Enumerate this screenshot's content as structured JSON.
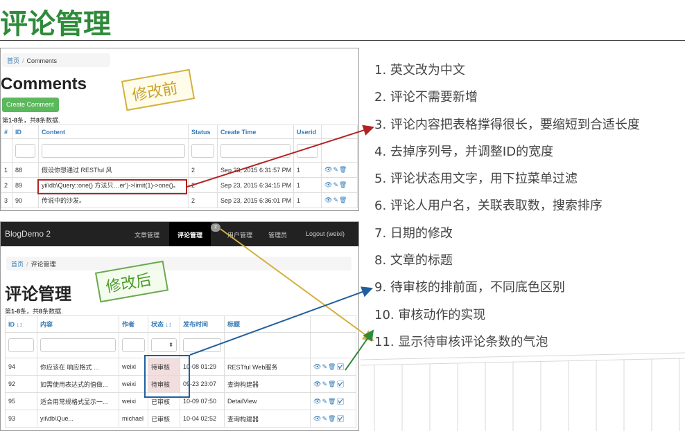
{
  "slide": {
    "title": "评论管理"
  },
  "before": {
    "stamp": "修改前",
    "breadcrumb": [
      "首页",
      "Comments"
    ],
    "heading": "Comments",
    "create_button": "Create Comment",
    "summary_prefix": "第",
    "summary_range": "1-8",
    "summary_mid": "条，共",
    "summary_total": "8",
    "summary_suffix": "条数据.",
    "columns": [
      "#",
      "ID",
      "Content",
      "Status",
      "Create Time",
      "Userid"
    ],
    "rows": [
      {
        "num": "1",
        "id": "88",
        "content": "假设你想通过 RESTful 风",
        "status": "2",
        "time": "Sep 23, 2015 6:31:57 PM",
        "userid": "1"
      },
      {
        "num": "2",
        "id": "89",
        "content": "yii\\db\\Query::one() 方法只…er')->limit(1)->one()。",
        "status": "2",
        "time": "Sep 23, 2015 6:34:15 PM",
        "userid": "1"
      },
      {
        "num": "3",
        "id": "90",
        "content": "传说中的沙发。",
        "status": "2",
        "time": "Sep 23, 2015 6:36:01 PM",
        "userid": "1"
      }
    ]
  },
  "after": {
    "stamp": "修改后",
    "brand": "BlogDemo 2",
    "nav": {
      "posts": "文章管理",
      "comments": "评论管理",
      "badge": "2",
      "users": "用户管理",
      "admins": "管理员",
      "logout": "Logout (weixi)"
    },
    "breadcrumb": [
      "首页",
      "评论管理"
    ],
    "heading": "评论管理",
    "summary_prefix": "第",
    "summary_range": "1-8",
    "summary_mid": "条，共",
    "summary_total": "8",
    "summary_suffix": "条数据.",
    "columns": [
      "ID ↓↕",
      "内容",
      "作者",
      "状态 ↓↕",
      "发布时间",
      "标题"
    ],
    "select_arrow": "⬍",
    "rows": [
      {
        "id": "94",
        "content": "你应该在 响应格式 ...",
        "author": "weixi",
        "status": "待审核",
        "pending": true,
        "time": "10-08 01:29",
        "title": "RESTful Web服务"
      },
      {
        "id": "92",
        "content": "如需使用表达式的值做...",
        "author": "weixi",
        "status": "待审核",
        "pending": true,
        "time": "09-23 23:07",
        "title": "查询构建器"
      },
      {
        "id": "95",
        "content": "适合用常规格式显示一...",
        "author": "weixi",
        "status": "已审核",
        "pending": false,
        "time": "10-09 07:50",
        "title": "DetailView"
      },
      {
        "id": "93",
        "content": "yii\\db\\Que...",
        "author": "michael",
        "status": "已审核",
        "pending": false,
        "time": "10-04 02:52",
        "title": "查询构建器"
      }
    ],
    "actions": "👁✎🗑☑"
  },
  "notes": [
    "1. 英文改为中文",
    "2. 评论不需要新增",
    "3. 评论内容把表格撑得很长，要缩短到合适长度",
    "4. 去掉序列号，并调整ID的宽度",
    "5. 评论状态用文字，用下拉菜单过滤",
    "6. 评论人用户名，关联表取数，搜索排序",
    "7. 日期的修改",
    "8. 文章的标题",
    "9. 待审核的排前面，不同底色区别",
    "10. 审核动作的实现",
    "11. 显示待审核评论条数的气泡"
  ],
  "colors": {
    "title_green": "#2e8b3a",
    "arrow_red": "#b22222",
    "arrow_yellow": "#d4b040",
    "arrow_blue": "#1f5f9e",
    "arrow_green": "#2e8b3a",
    "pending_bg": "#f2dede",
    "link_blue": "#337ab7"
  }
}
